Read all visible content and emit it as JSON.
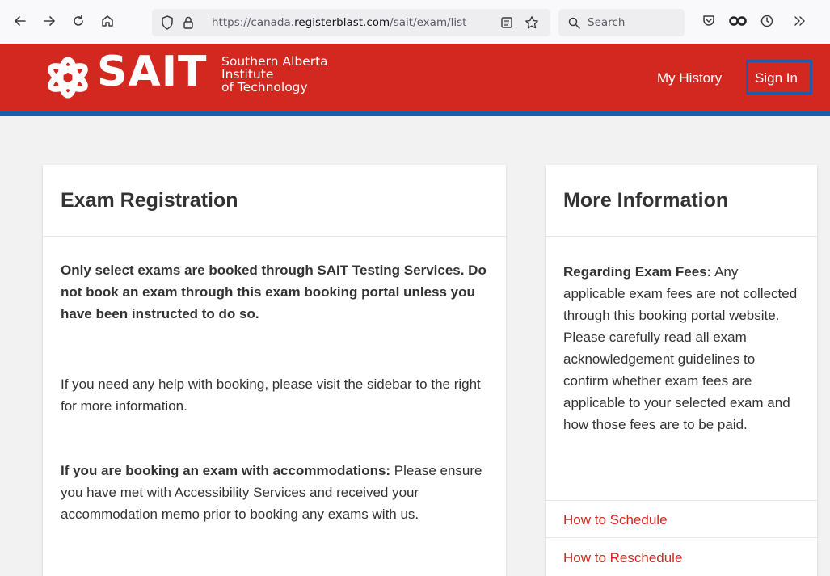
{
  "browser": {
    "url_prefix": "https://canada.",
    "url_domain": "registerblast.com",
    "url_path": "/sait/exam/list",
    "search_placeholder": "Search"
  },
  "header": {
    "logo_text": "SAIT",
    "logo_sub_line1": "Southern Alberta",
    "logo_sub_line2": "Institute",
    "logo_sub_line3": "of Technology",
    "nav_my_history": "My History",
    "nav_sign_in": "Sign In",
    "colors": {
      "brand_red": "#d3281f",
      "accent_blue": "#1f5ba8"
    }
  },
  "exam_card": {
    "title": "Exam Registration",
    "notice_bold": "Only select exams are booked through SAIT Testing Services. Do not book an exam through this exam booking portal unless you have been instructed to do so.",
    "help_text": "If you need any help with booking, please visit the sidebar to the right for more information.",
    "accommodations_label": "If you are booking an exam with accommodations:",
    "accommodations_text": " Please ensure you have met with Accessibility Services and received your accommodation memo prior to booking any exams with us."
  },
  "info_card": {
    "title": "More Information",
    "fees_label": "Regarding Exam Fees:",
    "fees_text": " Any applicable exam fees are not collected through this booking portal website. Please carefully read all exam acknowledgement guidelines to confirm whether exam fees are applicable to your selected exam and how those fees are to be paid.",
    "link_schedule": "How to Schedule",
    "link_reschedule": "How to Reschedule"
  }
}
